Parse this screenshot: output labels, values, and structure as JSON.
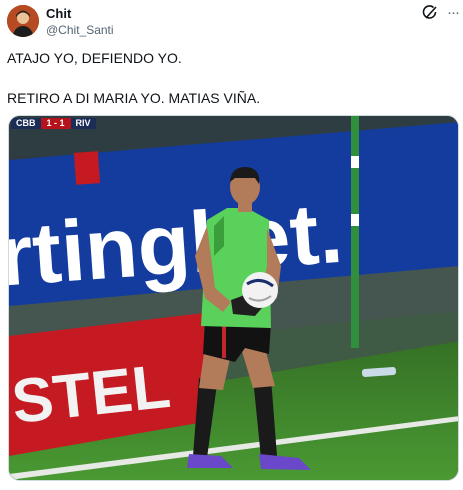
{
  "tweet": {
    "author_name": "Chit",
    "author_handle": "@Chit_Santi",
    "text_lines": [
      "ATAJO YO, DEFIENDO YO.",
      "RETIRO A DI MARIA YO. MATIAS VIÑA."
    ]
  },
  "header_icons": {
    "grok": "grok-icon",
    "more": "more-options-icon",
    "more_glyph": "···"
  },
  "media": {
    "scorebug": {
      "home": "CBB",
      "score": "1 - 1",
      "away": "RIV"
    },
    "board_text": "rtingbet.",
    "board_text_2": "STEL",
    "colors": {
      "board_blue": "#123a9c",
      "board_red": "#c51a22",
      "pitch": "#3d8a2a",
      "jersey": "#5ad15a"
    }
  }
}
